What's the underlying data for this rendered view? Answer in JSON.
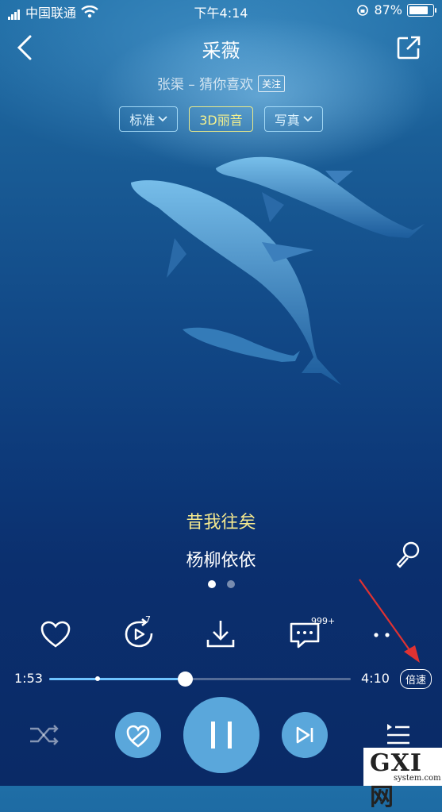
{
  "status_bar": {
    "carrier": "中国联通",
    "time": "下午4:14",
    "battery": "87%",
    "battery_level": 0.87
  },
  "header": {
    "title": "采薇",
    "artist_line": "张渠 – 猜你喜欢",
    "follow_label": "关注"
  },
  "quality_chips": [
    {
      "label": "标准",
      "has_dropdown": true
    },
    {
      "label": "3D丽音",
      "has_dropdown": false,
      "active": true
    },
    {
      "label": "写真",
      "has_dropdown": true
    }
  ],
  "lyrics": {
    "current": "昔我往矣",
    "next": "杨柳依依"
  },
  "page_indicator": {
    "count": 2,
    "active": 0
  },
  "actions": {
    "like_icon": "heart-icon",
    "replay_count": "7",
    "download_icon": "download-icon",
    "comment_count": "999+",
    "more_icon": "more-icon"
  },
  "progress": {
    "current": "1:53",
    "total": "4:10",
    "fraction": 0.45,
    "speed_label": "倍速"
  },
  "watermark": {
    "brand": "GXI网",
    "domain": "system.com"
  },
  "colors": {
    "accent": "#5aa7db",
    "lyric_current": "#f4e88e"
  }
}
